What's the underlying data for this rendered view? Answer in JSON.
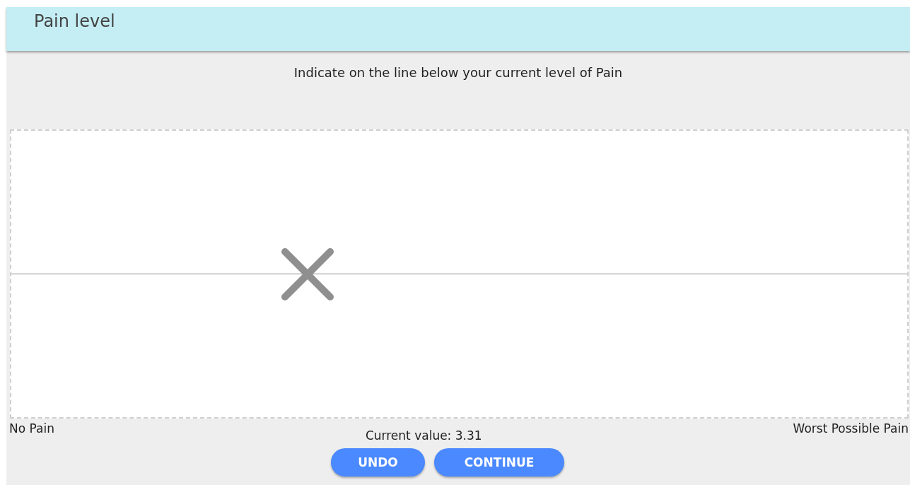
{
  "header": {
    "title": "Pain level"
  },
  "prompt": "Indicate on the line below your current level of Pain",
  "scale": {
    "level": 0.331,
    "min_label": "No Pain",
    "max_label": "Worst Possible Pain"
  },
  "current_value": "Current value: 3.31",
  "buttons": [
    {
      "label": "UNDO"
    },
    {
      "label": "CONTINUE"
    }
  ]
}
